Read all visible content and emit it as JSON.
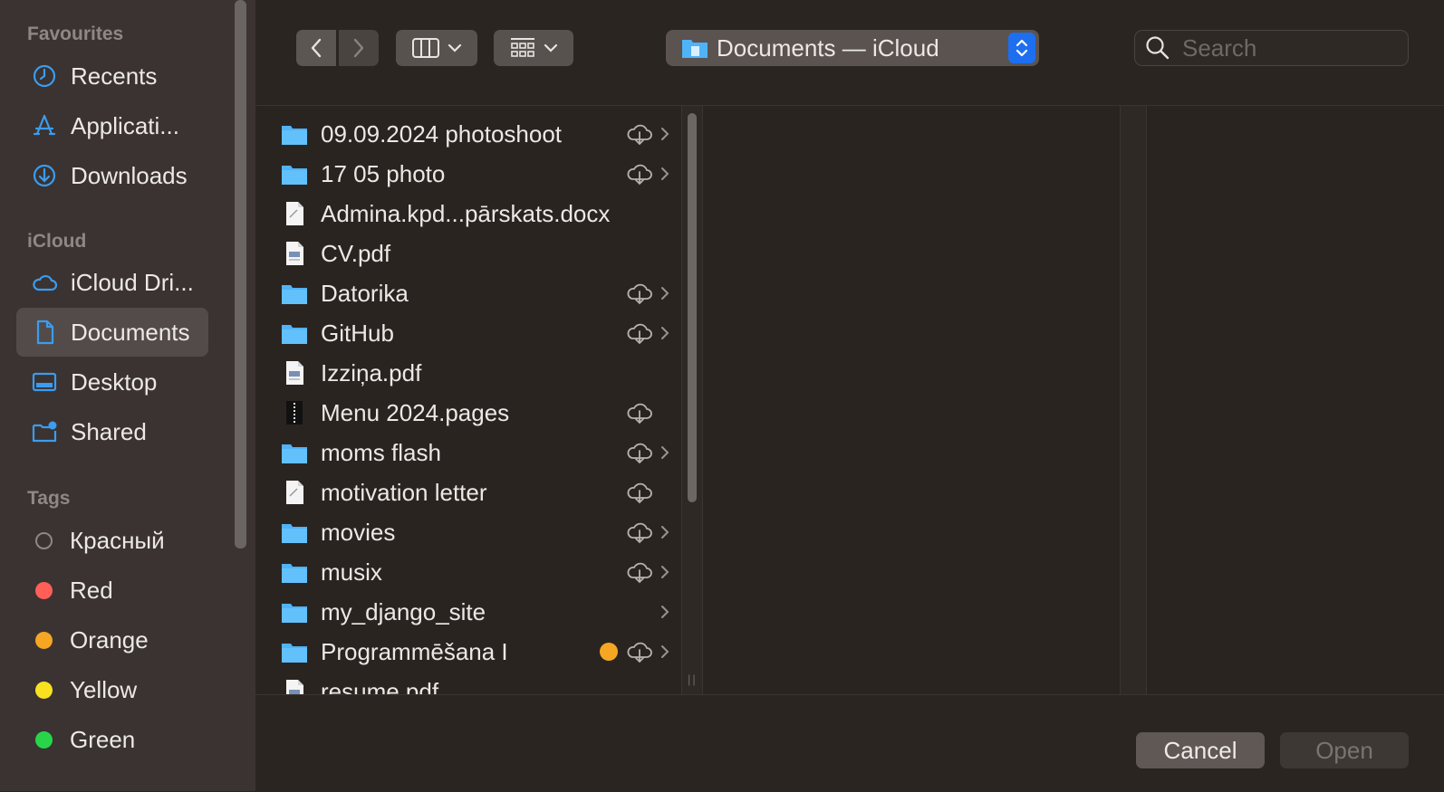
{
  "sidebar": {
    "favourites_heading": "Favourites",
    "favourites": [
      {
        "label": "Recents",
        "icon": "clock-icon"
      },
      {
        "label": "Applicati...",
        "icon": "applications-icon"
      },
      {
        "label": "Downloads",
        "icon": "download-icon"
      }
    ],
    "icloud_heading": "iCloud",
    "icloud": [
      {
        "label": "iCloud Dri...",
        "icon": "cloud-icon"
      },
      {
        "label": "Documents",
        "icon": "document-icon",
        "selected": true
      },
      {
        "label": "Desktop",
        "icon": "desktop-icon"
      },
      {
        "label": "Shared",
        "icon": "shared-folder-icon"
      }
    ],
    "tags_heading": "Tags",
    "tags": [
      {
        "label": "Красный",
        "color": "#8e8885",
        "hollow": true
      },
      {
        "label": "Red",
        "color": "#ff5f57"
      },
      {
        "label": "Orange",
        "color": "#f5a623"
      },
      {
        "label": "Yellow",
        "color": "#f8e21f"
      },
      {
        "label": "Green",
        "color": "#28d54a"
      }
    ]
  },
  "toolbar": {
    "back_icon": "chevron-left-icon",
    "forward_icon": "chevron-right-icon",
    "view_icon": "columns-view-icon",
    "group_icon": "grid-group-icon",
    "location": "Documents — iCloud",
    "search_placeholder": "Search"
  },
  "files": [
    {
      "name": "09.09.2024 photoshoot",
      "type": "folder",
      "cloud": true,
      "chevron": true
    },
    {
      "name": "17 05 photo",
      "type": "folder",
      "cloud": true,
      "chevron": true
    },
    {
      "name": "Admina.kpd...pārskats.docx",
      "type": "doc",
      "cloud": false,
      "chevron": false
    },
    {
      "name": "CV.pdf",
      "type": "pdf",
      "cloud": false,
      "chevron": false
    },
    {
      "name": "Datorika",
      "type": "folder",
      "cloud": true,
      "chevron": true
    },
    {
      "name": "GitHub",
      "type": "folder",
      "cloud": true,
      "chevron": true
    },
    {
      "name": "Izziņa.pdf",
      "type": "pdf",
      "cloud": false,
      "chevron": false
    },
    {
      "name": "Menu 2024.pages",
      "type": "zip",
      "cloud": true,
      "chevron": false
    },
    {
      "name": "moms flash",
      "type": "folder",
      "cloud": true,
      "chevron": true
    },
    {
      "name": "motivation letter",
      "type": "doc",
      "cloud": true,
      "chevron": false
    },
    {
      "name": "movies",
      "type": "folder",
      "cloud": true,
      "chevron": true
    },
    {
      "name": "musix",
      "type": "folder",
      "cloud": true,
      "chevron": true
    },
    {
      "name": "my_django_site",
      "type": "folder",
      "cloud": false,
      "chevron": true
    },
    {
      "name": "Programmēšana I",
      "type": "folder",
      "cloud": true,
      "chevron": true,
      "tag": "#f5a623"
    },
    {
      "name": "resume.pdf",
      "type": "pdf",
      "cloud": false,
      "chevron": false
    }
  ],
  "buttons": {
    "cancel": "Cancel",
    "open": "Open"
  },
  "colors": {
    "accent": "#1e6ef0",
    "folder": "#4fb3f6",
    "sidebar_icon": "#3b9cf0"
  }
}
